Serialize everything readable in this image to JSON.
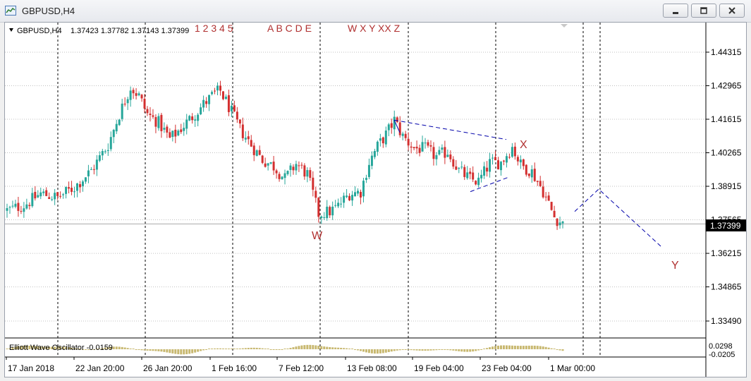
{
  "window": {
    "title": "GBPUSD,H4"
  },
  "chart_info": {
    "symbol": "GBPUSD,H4",
    "ohlc": "1.37423 1.37782 1.37143 1.37399"
  },
  "wave_labels": {
    "impulse": "1 2 3 4 5",
    "correction": "A B C D E",
    "complex": "W X Y XX Z"
  },
  "annotations": [
    {
      "text": "W",
      "time": "7 Feb 12:00",
      "price": 1.3712
    },
    {
      "text": "X",
      "time": "23 Feb 04:00",
      "price": 1.4042
    },
    {
      "text": "Y",
      "time": "3 Mar",
      "price": 1.3592
    }
  ],
  "indicator": {
    "label": "Elliott Wave Oscillator -0.0159",
    "upper": "0.0298",
    "lower": "-0.0205"
  },
  "price_tag": "1.37399",
  "colors": {
    "bull": "#26a69a",
    "bear": "#d32f2f",
    "wave_label": "#b03030",
    "trendline": "#0000aa",
    "osc": "#c8b870",
    "grid": "#c0c0c0"
  },
  "chart_data": {
    "type": "candlestick",
    "title": "GBPUSD,H4",
    "y_ticks": [
      "1.44315",
      "1.42965",
      "1.41615",
      "1.40265",
      "1.38915",
      "1.37565",
      "1.36215",
      "1.34865",
      "1.33490"
    ],
    "x_ticks": [
      "17 Jan 2018",
      "22 Jan 20:00",
      "26 Jan 20:00",
      "1 Feb 16:00",
      "7 Feb 12:00",
      "13 Feb 08:00",
      "19 Feb 04:00",
      "23 Feb 04:00",
      "1 Mar 00:00"
    ],
    "ylim": [
      1.3295,
      1.4545
    ],
    "current_price": 1.37399,
    "close_path": [
      [
        0,
        1.3795
      ],
      [
        6,
        1.3815
      ],
      [
        12,
        1.3862
      ],
      [
        18,
        1.3846
      ],
      [
        24,
        1.3888
      ],
      [
        30,
        1.3955
      ],
      [
        36,
        1.4058
      ],
      [
        40,
        1.4182
      ],
      [
        44,
        1.4292
      ],
      [
        47,
        1.4255
      ],
      [
        50,
        1.4182
      ],
      [
        54,
        1.4148
      ],
      [
        58,
        1.4082
      ],
      [
        62,
        1.4125
      ],
      [
        66,
        1.4172
      ],
      [
        70,
        1.4222
      ],
      [
        74,
        1.4266
      ],
      [
        76,
        1.4275
      ],
      [
        79,
        1.4212
      ],
      [
        83,
        1.4122
      ],
      [
        87,
        1.4058
      ],
      [
        91,
        1.3998
      ],
      [
        95,
        1.3972
      ],
      [
        99,
        1.3922
      ],
      [
        103,
        1.3982
      ],
      [
        107,
        1.394
      ],
      [
        111,
        1.378
      ],
      [
        115,
        1.379
      ],
      [
        118,
        1.3812
      ],
      [
        122,
        1.3862
      ],
      [
        126,
        1.387
      ],
      [
        129,
        1.3988
      ],
      [
        132,
        1.4052
      ],
      [
        135,
        1.41
      ],
      [
        138,
        1.4158
      ],
      [
        141,
        1.4092
      ],
      [
        145,
        1.4045
      ],
      [
        149,
        1.4042
      ],
      [
        153,
        1.401
      ],
      [
        157,
        1.4032
      ],
      [
        161,
        1.3955
      ],
      [
        165,
        1.392
      ],
      [
        168,
        1.391
      ],
      [
        172,
        1.3985
      ],
      [
        176,
        1.3988
      ],
      [
        180,
        1.405
      ],
      [
        183,
        1.3978
      ],
      [
        187,
        1.395
      ],
      [
        191,
        1.3872
      ],
      [
        195,
        1.3768
      ],
      [
        198,
        1.374
      ]
    ],
    "trendlines": [
      {
        "points": [
          [
            "13 Feb 14:00",
            1.4158
          ],
          [
            "23 Feb 00:00",
            1.408
          ]
        ],
        "style": "dashed"
      },
      {
        "points": [
          [
            "20 Feb 20:00",
            1.387
          ],
          [
            "23 Feb 04:00",
            1.393
          ]
        ],
        "style": "dashed"
      },
      {
        "points": [
          [
            "1 Mar 04:00",
            1.379
          ],
          [
            "1 Mar 20:00",
            1.388
          ],
          [
            "3 Mar",
            1.3645
          ]
        ],
        "style": "dashed"
      }
    ]
  }
}
